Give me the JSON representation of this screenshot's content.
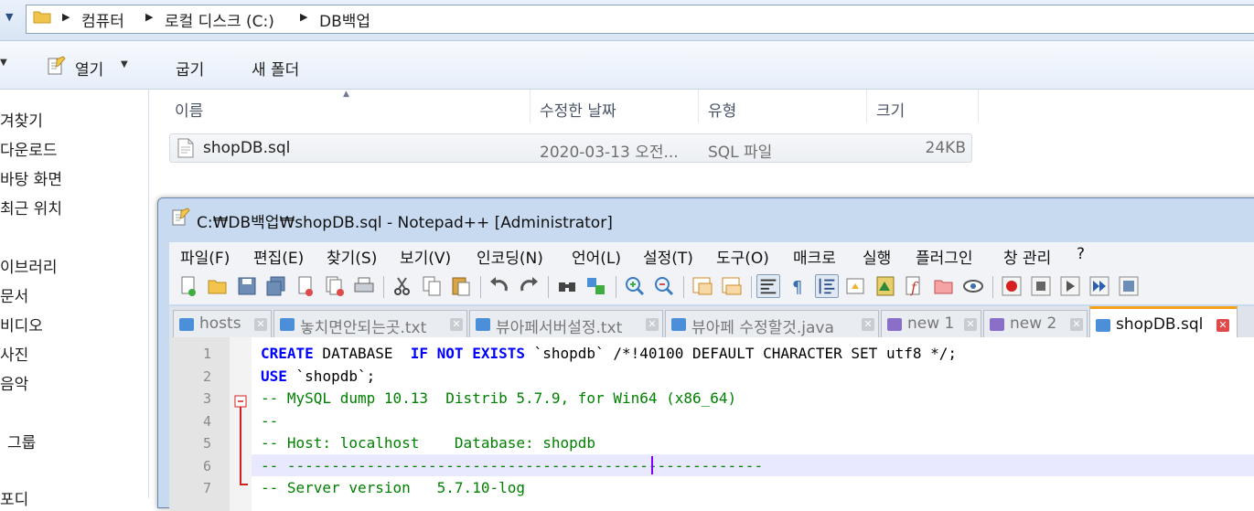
{
  "explorer": {
    "breadcrumb": [
      "컴퓨터",
      "로컬 디스크 (C:)",
      "DB백업"
    ],
    "toolbar": {
      "open_label": "열기",
      "burn_label": "굽기",
      "new_folder_label": "새 폴더"
    },
    "nav_items": [
      "겨찾기",
      "다운로드",
      "바탕 화면",
      "최근 위치",
      "이브러리",
      "문서",
      "비디오",
      "사진",
      "음악",
      "그룹",
      "포디"
    ],
    "columns": {
      "name": "이름",
      "modified": "수정한 날짜",
      "type": "유형",
      "size": "크기"
    },
    "file": {
      "name": "shopDB.sql",
      "modified": "2020-03-13 오전...",
      "type": "SQL 파일",
      "size": "24KB"
    }
  },
  "npp": {
    "title": "C:₩DB백업₩shopDB.sql - Notepad++ [Administrator]",
    "menu": [
      "파일(F)",
      "편집(E)",
      "찾기(S)",
      "보기(V)",
      "인코딩(N)",
      "언어(L)",
      "설정(T)",
      "도구(O)",
      "매크로",
      "실행",
      "플러그인",
      "창 관리",
      "?"
    ],
    "tabs": [
      {
        "label": "hosts",
        "color": "#4a8fd8"
      },
      {
        "label": "놓치면안되는곳.txt",
        "color": "#4a8fd8"
      },
      {
        "label": "뷰아페서버설정.txt",
        "color": "#4a8fd8"
      },
      {
        "label": "뷰아페 수정할것.java",
        "color": "#4a8fd8"
      },
      {
        "label": "new 1",
        "color": "#8a6fc9"
      },
      {
        "label": "new 2",
        "color": "#8a6fc9"
      },
      {
        "label": "shopDB.sql",
        "color": "#4a8fd8",
        "active": true
      }
    ],
    "line_numbers": [
      "1",
      "2",
      "3",
      "4",
      "5",
      "6",
      "7"
    ],
    "code": {
      "l1_kw1": "CREATE",
      "l1_t1": " DATABASE  ",
      "l1_kw2": "IF NOT EXISTS",
      "l1_t2": " `shopdb` /*!40100 DEFAULT CHARACTER SET utf8 */;",
      "l2_kw": "USE",
      "l2_t": " `shopdb`;",
      "l3": "-- MySQL dump 10.13  Distrib 5.7.9, for Win64 (x86_64)",
      "l4": "--",
      "l5": "-- Host: localhost    Database: shopdb",
      "l6": "-- ------------------------------------------------------",
      "l7": "-- Server version\t5.7.10-log"
    },
    "colors": {
      "keyword": "#0000ff",
      "comment": "#008000",
      "active_tab_accent": "#f9a11b"
    }
  }
}
